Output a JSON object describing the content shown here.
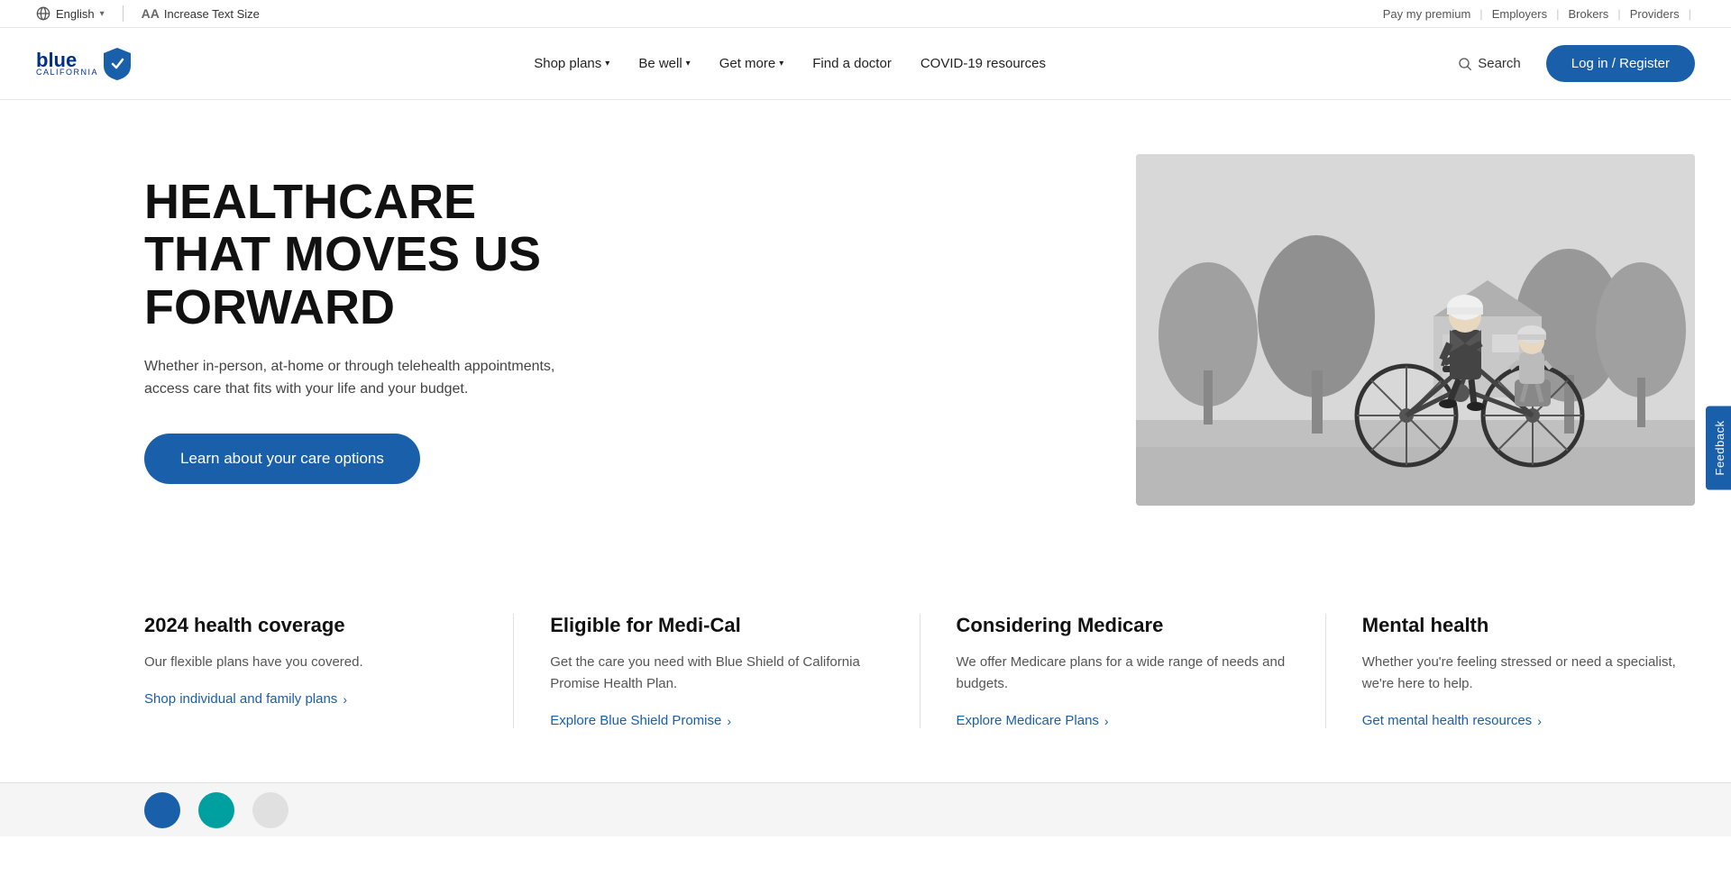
{
  "topbar": {
    "language": "English",
    "increase_text_size": "Increase Text Size",
    "links": [
      {
        "label": "Pay my premium",
        "href": "#"
      },
      {
        "label": "Employers",
        "href": "#"
      },
      {
        "label": "Brokers",
        "href": "#"
      },
      {
        "label": "Providers",
        "href": "#"
      }
    ]
  },
  "nav": {
    "logo": {
      "blue": "blue",
      "california": "california",
      "shield": "🛡"
    },
    "links": [
      {
        "label": "Shop plans",
        "has_dropdown": true
      },
      {
        "label": "Be well",
        "has_dropdown": true
      },
      {
        "label": "Get more",
        "has_dropdown": true
      },
      {
        "label": "Find a doctor",
        "has_dropdown": false
      },
      {
        "label": "COVID-19 resources",
        "has_dropdown": false
      }
    ],
    "search_label": "Search",
    "login_label": "Log in / Register"
  },
  "hero": {
    "title": "HEALTHCARE THAT MOVES US FORWARD",
    "subtitle": "Whether in-person, at-home or through telehealth appointments, access care that fits with your life and your budget.",
    "cta_label": "Learn about your care options"
  },
  "cards": [
    {
      "title": "2024 health coverage",
      "desc": "Our flexible plans have you covered.",
      "link_label": "Shop individual and family plans",
      "link_href": "#"
    },
    {
      "title": "Eligible for Medi-Cal",
      "desc": "Get the care you need with Blue Shield of California Promise Health Plan.",
      "link_label": "Explore Blue Shield Promise",
      "link_href": "#"
    },
    {
      "title": "Considering Medicare",
      "desc": "We offer Medicare plans for a wide range of needs and budgets.",
      "link_label": "Explore Medicare Plans",
      "link_href": "#"
    },
    {
      "title": "Mental health",
      "desc": "Whether you're feeling stressed or need a specialist, we're here to help.",
      "link_label": "Get mental health resources",
      "link_href": "#"
    }
  ],
  "feedback": {
    "label": "Feedback"
  },
  "colors": {
    "primary_blue": "#1a5faa",
    "dark_navy": "#003087"
  }
}
